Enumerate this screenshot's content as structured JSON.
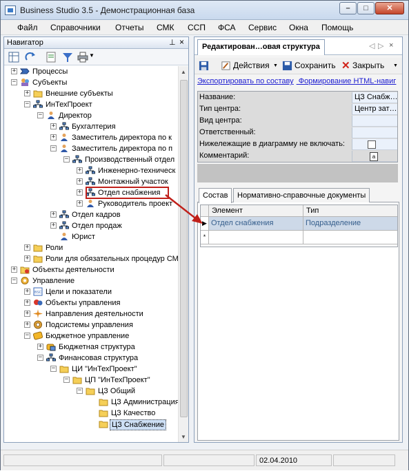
{
  "window": {
    "title": "Business Studio 3.5 - Демонстрационная база"
  },
  "menu": [
    "Файл",
    "Справочники",
    "Отчеты",
    "СМК",
    "ССП",
    "ФСА",
    "Сервис",
    "Окна",
    "Помощь"
  ],
  "navigator": {
    "title": "Навигатор",
    "tree": [
      {
        "label": "Процессы",
        "level": 0,
        "icon": "process-icon",
        "expander": "+"
      },
      {
        "label": "Субъекты",
        "level": 0,
        "icon": "subjects-icon",
        "expander": "-"
      },
      {
        "label": "Внешние субъекты",
        "level": 1,
        "icon": "folder-icon",
        "expander": "+"
      },
      {
        "label": "ИнТехПроект",
        "level": 1,
        "icon": "org-icon",
        "expander": "-"
      },
      {
        "label": "Директор",
        "level": 2,
        "icon": "person-icon",
        "expander": "-"
      },
      {
        "label": "Бухгалтерия",
        "level": 3,
        "icon": "org-icon",
        "expander": "+"
      },
      {
        "label": "Заместитель директора по к",
        "level": 3,
        "icon": "person-icon",
        "expander": "+"
      },
      {
        "label": "Заместитель директора по п",
        "level": 3,
        "icon": "person-icon",
        "expander": "-"
      },
      {
        "label": "Производственный отдел",
        "level": 4,
        "icon": "org-icon",
        "expander": "-"
      },
      {
        "label": "Инженерно-техническ",
        "level": 5,
        "icon": "org-icon",
        "expander": "+"
      },
      {
        "label": "Монтажный участок",
        "level": 5,
        "icon": "org-icon",
        "expander": "+"
      },
      {
        "label": "Отдел снабжения",
        "level": 5,
        "icon": "org-icon",
        "expander": "+"
      },
      {
        "label": "Руководитель проект",
        "level": 5,
        "icon": "person-icon",
        "expander": "+"
      },
      {
        "label": "Отдел кадров",
        "level": 3,
        "icon": "org-icon",
        "expander": "+"
      },
      {
        "label": "Отдел продаж",
        "level": 3,
        "icon": "org-icon",
        "expander": "+"
      },
      {
        "label": "Юрист",
        "level": 3,
        "icon": "person-icon",
        "expander": ""
      },
      {
        "label": "Роли",
        "level": 1,
        "icon": "folder-icon",
        "expander": "+"
      },
      {
        "label": "Роли для обязательных процедур СМ",
        "level": 1,
        "icon": "folder-icon",
        "expander": "+"
      },
      {
        "label": "Объекты деятельности",
        "level": 0,
        "icon": "objects-icon",
        "expander": "+"
      },
      {
        "label": "Управление",
        "level": 0,
        "icon": "management-icon",
        "expander": "-"
      },
      {
        "label": "Цели и показатели",
        "level": 1,
        "icon": "bsc-icon",
        "expander": "+"
      },
      {
        "label": "Объекты управления",
        "level": 1,
        "icon": "mgmt-objects-icon",
        "expander": "+"
      },
      {
        "label": "Направления деятельности",
        "level": 1,
        "icon": "directions-icon",
        "expander": "+"
      },
      {
        "label": "Подсистемы управления",
        "level": 1,
        "icon": "subsystems-icon",
        "expander": "+"
      },
      {
        "label": "Бюджетное управление",
        "level": 1,
        "icon": "budget-icon",
        "expander": "-"
      },
      {
        "label": "Бюджетная структура",
        "level": 2,
        "icon": "budget-structure-icon",
        "expander": "+"
      },
      {
        "label": "Финансовая структура",
        "level": 2,
        "icon": "org-icon",
        "expander": "-"
      },
      {
        "label": "ЦИ \"ИнТехПроект\"",
        "level": 3,
        "icon": "folder-icon",
        "expander": "-"
      },
      {
        "label": "ЦП \"ИнТехПроект\"",
        "level": 4,
        "icon": "folder-icon",
        "expander": "-"
      },
      {
        "label": "ЦЗ Общий",
        "level": 5,
        "icon": "folder-icon",
        "expander": "-"
      },
      {
        "label": "ЦЗ Администрация",
        "level": 6,
        "icon": "folder-icon",
        "expander": ""
      },
      {
        "label": "ЦЗ Качество",
        "level": 6,
        "icon": "folder-icon",
        "expander": ""
      },
      {
        "label": "ЦЗ Снабжение",
        "level": 6,
        "icon": "folder-icon",
        "expander": "",
        "selected": true
      }
    ]
  },
  "editor": {
    "tab_title": "Редактирован…овая структура",
    "toolbar": {
      "actions": "Действия",
      "save": "Сохранить",
      "close": "Закрыть"
    },
    "links": [
      "Экспортировать по составу",
      "Формирование HTML-навиг"
    ],
    "properties": [
      {
        "key": "Название:",
        "value": "ЦЗ Снабж…"
      },
      {
        "key": "Тип центра:",
        "value": "Центр зат…"
      },
      {
        "key": "Вид центра:",
        "value": ""
      },
      {
        "key": "Ответственный:",
        "value": ""
      },
      {
        "key": "Нижележащие в диаграмму не включать:",
        "value": ""
      },
      {
        "key": "Комментарий:",
        "value": ""
      }
    ],
    "subtabs": [
      "Состав",
      "Нормативно-справочные документы"
    ],
    "grid": {
      "headers": [
        "Элемент",
        "Тип"
      ],
      "rows": [
        {
          "element": "Отдел снабжения",
          "type": "Подразделение"
        }
      ],
      "new_row_marker": "*"
    }
  },
  "status": {
    "date": "02.04.2010"
  },
  "colors": {
    "highlight": "#c0201a",
    "selection": "#cdd9e8",
    "accent": "#3c7bc8"
  }
}
